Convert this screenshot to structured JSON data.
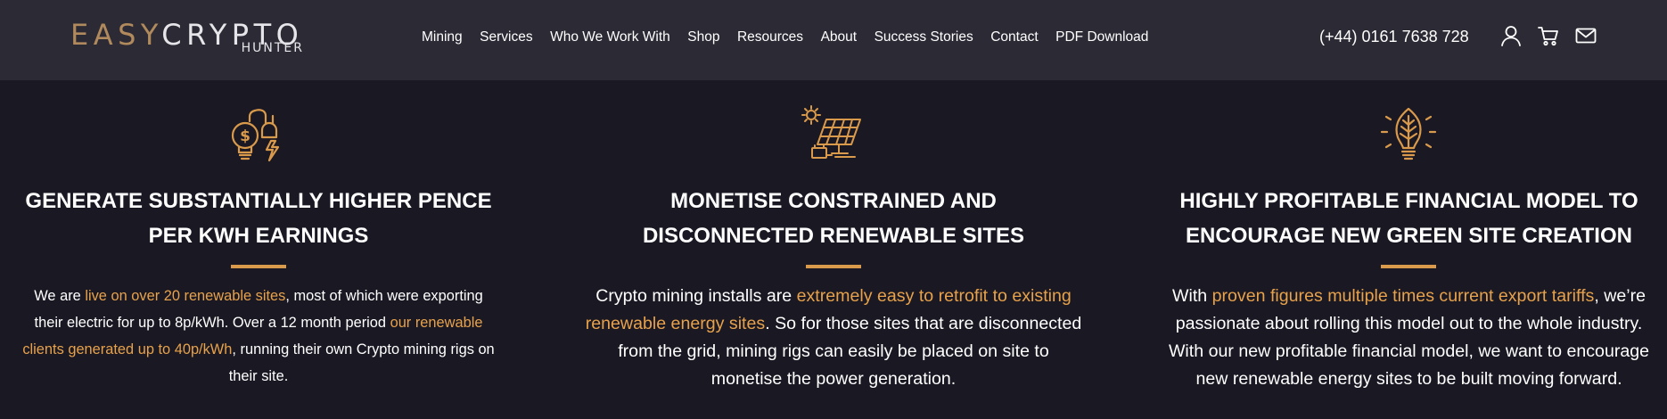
{
  "brand": {
    "logo_easy": "EASY",
    "logo_crypto": "CRYPTO",
    "logo_sub": "HUNTER",
    "colors": {
      "accent": "#d99a4b",
      "highlight_text": "#e7a24b",
      "header_bg": "#2b2a35",
      "page_bg": "#1a1823"
    }
  },
  "nav": {
    "items": [
      "Mining",
      "Services",
      "Who We Work With",
      "Shop",
      "Resources",
      "About",
      "Success Stories",
      "Contact",
      "PDF Download"
    ]
  },
  "header": {
    "phone": "(+44) 0161 7638 728",
    "icons": [
      "user-icon",
      "cart-icon",
      "mail-icon"
    ]
  },
  "features": [
    {
      "icon": "lightbulb-plug-icon",
      "title_line1": "GENERATE SUBSTANTIALLY HIGHER PENCE",
      "title_line2": "PER KWH EARNINGS",
      "body": {
        "t1": "We are ",
        "h1": "live on over 20 renewable sites",
        "t2": ", most of which were exporting their electric for up to 8p/kWh. Over a 12 month period ",
        "h2": "our renewable clients generated up to 40p/kWh",
        "t3": ", running their own Crypto mining rigs on their site."
      }
    },
    {
      "icon": "solar-panel-icon",
      "title_line1": "MONETISE CONSTRAINED AND",
      "title_line2": "DISCONNECTED RENEWABLE SITES",
      "body": {
        "t1": "Crypto mining installs are ",
        "h1": "extremely easy to retrofit to existing renewable energy sites",
        "t2": ". So for those sites that are disconnected from the grid, mining rigs can easily be placed on site to monetise the power generation."
      }
    },
    {
      "icon": "leaf-bulb-icon",
      "title_line1": "HIGHLY PROFITABLE FINANCIAL MODEL TO",
      "title_line2": "ENCOURAGE NEW GREEN SITE CREATION",
      "body": {
        "t1": "With ",
        "h1": "proven figures multiple times current export tariffs",
        "t2": ", we’re passionate about rolling this model out to the whole industry. With our new profitable financial model, we want to encourage new renewable energy sites to be built moving forward."
      }
    }
  ]
}
